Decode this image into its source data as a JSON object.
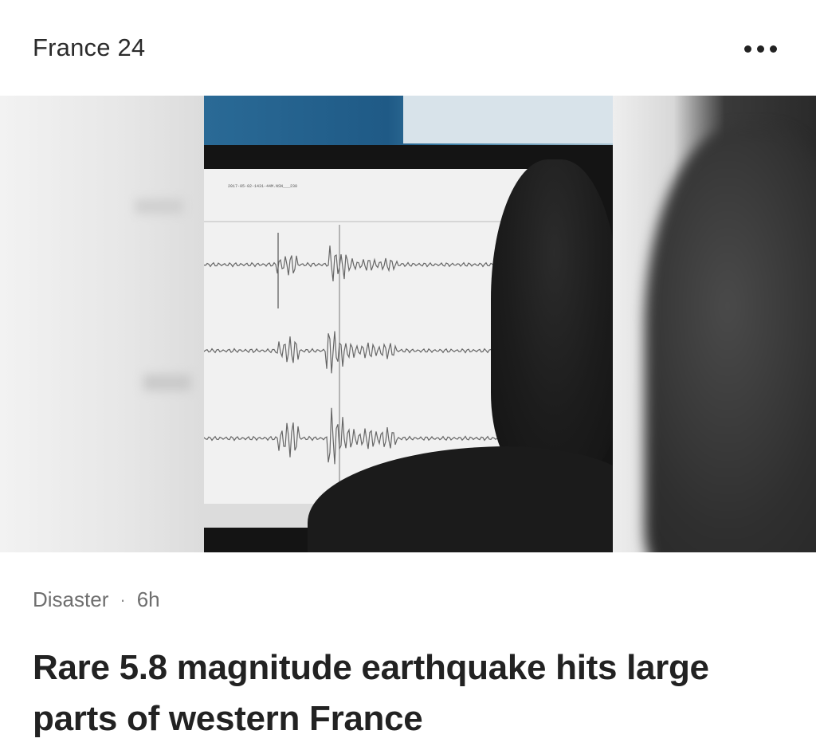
{
  "header": {
    "source": "France 24",
    "more_icon": "more-horizontal-icon"
  },
  "hero": {
    "screen_header": "2017-05-02-1431-44M.NSN___230"
  },
  "meta": {
    "category": "Disaster",
    "separator": "·",
    "time": "6h"
  },
  "article": {
    "headline": "Rare 5.8 magnitude earthquake hits large parts of western France"
  },
  "colors": {
    "text_primary": "#222222",
    "text_secondary": "#6e6e6e",
    "background": "#ffffff"
  }
}
